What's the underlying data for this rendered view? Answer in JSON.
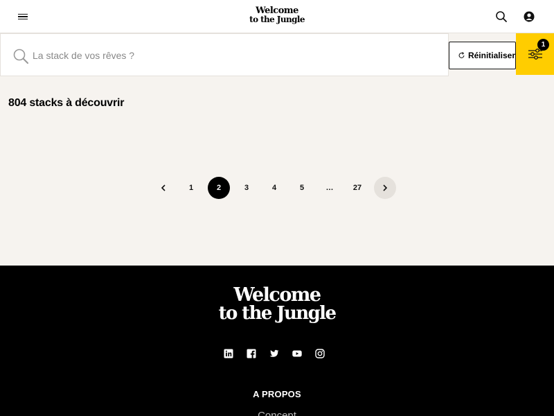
{
  "header": {
    "logo_line1": "Welcome",
    "logo_line2": "to the Jungle",
    "icons": [
      "menu-icon",
      "search-icon",
      "user-icon"
    ]
  },
  "search": {
    "placeholder": "La stack de vos rêves ?",
    "value": "",
    "reset_label": "Réinitialiser",
    "filter_count": "1"
  },
  "results": {
    "count_label": "804 stacks à découvrir"
  },
  "pagination": {
    "pages": [
      "1",
      "2",
      "3",
      "4",
      "5",
      "…",
      "27"
    ],
    "current": "2",
    "ellipsis": "…"
  },
  "footer": {
    "logo_line1": "Welcome",
    "logo_line2": "to the Jungle",
    "socials": [
      "linkedin-icon",
      "facebook-icon",
      "twitter-icon",
      "youtube-icon",
      "instagram-icon"
    ],
    "heading": "A PROPOS",
    "link": "Concept"
  },
  "colors": {
    "accent": "#ffcd00",
    "page_bg": "#f6f3ef",
    "footer_bg": "#000000"
  }
}
